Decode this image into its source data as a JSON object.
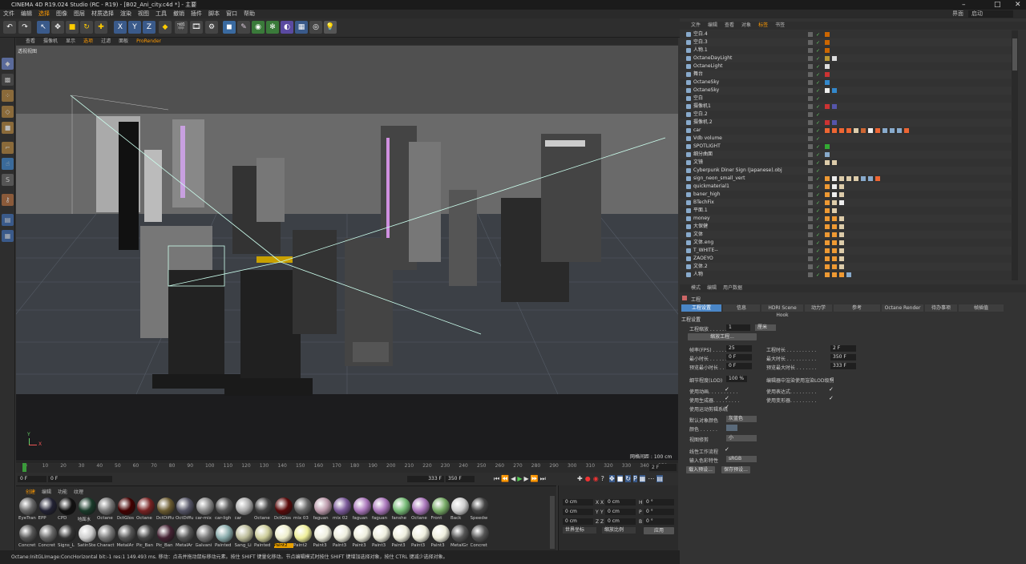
{
  "window": {
    "title": "CINEMA 4D R19.024 Studio (RC - R19) - [B02_Ani_city.c4d *] - 主要"
  },
  "menubar": {
    "items": [
      "文件",
      "编辑",
      "选择",
      "图像",
      "图层",
      "材质选择",
      "渲染",
      "视图",
      "工具",
      "撤销",
      "插件",
      "脚本",
      "窗口",
      "帮助"
    ],
    "active": "选择"
  },
  "layout": {
    "label": "界面",
    "value": "启动"
  },
  "toolbar": {
    "x": "X",
    "y": "Y",
    "z": "Z"
  },
  "viewport": {
    "menu": [
      "查看",
      "摄像机",
      "显示",
      "选项",
      "过滤",
      "面板",
      "ProRender"
    ],
    "label": "透视视图",
    "grid_label": "网格间距 : 100 cm",
    "axis_y": "Y",
    "axis_x": "X",
    "axis_z": "Z"
  },
  "timeline": {
    "ticks": [
      "0",
      "10",
      "20",
      "30",
      "40",
      "50",
      "60",
      "70",
      "80",
      "90",
      "100",
      "110",
      "120",
      "130",
      "140",
      "150",
      "160",
      "170",
      "180",
      "190",
      "200",
      "210",
      "220",
      "230",
      "240",
      "250",
      "260",
      "270",
      "280",
      "290",
      "300",
      "310",
      "320",
      "330",
      "340",
      "350"
    ],
    "current_frame": "2 F"
  },
  "transport": {
    "start": "0 F",
    "field2": "0 F",
    "end_a": "333 F",
    "end_b": "350 F"
  },
  "materials": {
    "menu": [
      "创建",
      "编辑",
      "功能",
      "纹理"
    ],
    "row1": [
      "EyeTran",
      "EPP",
      "CPD",
      "地面水",
      "Octane",
      "OctGlos",
      "Octane",
      "OctDiffu",
      "OctDiffu",
      "car-mix",
      "car-ligh",
      "car",
      "Octane",
      "OctGlos",
      "mix 03",
      "faguan",
      "mix 02",
      "faguan",
      "faguan",
      "fanshe",
      "Octane",
      "Front",
      "Back",
      "Speedw"
    ],
    "row2": [
      "Concret",
      "Concret",
      "Signs_L",
      "SatinSte",
      "Charact",
      "MetalAr",
      "Pic_Ban",
      "Pic_Ban",
      "MetalAr",
      "Galvani",
      "Painted",
      "Sang_Li",
      "Painted",
      "Paint2",
      "Paint2",
      "Paint3",
      "Paint3",
      "Paint3",
      "Paint3",
      "Paint3",
      "Paint3",
      "Paint3",
      "MetalGr",
      "Concret"
    ],
    "highlight": "Painted",
    "colors1": [
      "#666",
      "#223",
      "#111",
      "#1a3a2a",
      "#777",
      "#400",
      "#722",
      "#6a5a30",
      "#556",
      "#888",
      "#555",
      "#aaa",
      "#444",
      "#5a0a0a",
      "#666",
      "#b9a",
      "#7b5a9a",
      "#a7b",
      "#a7b",
      "#7b7",
      "#a7b",
      "#7a6",
      "#ccc",
      "#444"
    ],
    "colors2": [
      "#555",
      "#666",
      "#333",
      "#ccc",
      "#777",
      "#555",
      "#444",
      "#423",
      "#555",
      "#777",
      "#8aa",
      "#bb9",
      "#cc9",
      "#eec",
      "#ee9",
      "#eed",
      "#eed",
      "#eed",
      "#eed",
      "#eed",
      "#eed",
      "#eed",
      "#555",
      "#555"
    ]
  },
  "coords": {
    "x1": "X",
    "y1": "Y",
    "z1": "Z",
    "val": "0 cm",
    "x2": "X",
    "y2": "Y",
    "z2": "Z",
    "h": "H",
    "p": "P",
    "b": "B",
    "deg": "0 °",
    "mode1": "世界坐标",
    "mode2": "缩放比例",
    "apply": "应用"
  },
  "status": {
    "text": "Octane:InitGLImage:ConcHorizontal  bit:-1 res:1 149.493 ms.  移动：点击并拖动鼠标移动元素。按住 SHIFT 键量化移动。节点编辑模式时按住 SHIFT 键增加选择对象，按住 CTRL 键减少选择对象。"
  },
  "objmanager": {
    "menu": [
      "文件",
      "编辑",
      "查看",
      "对象",
      "标签",
      "书签"
    ],
    "active": "标签"
  },
  "objects": [
    {
      "name": "空白.4",
      "tags": [
        "#c60"
      ]
    },
    {
      "name": "空白.3",
      "tags": [
        "#c60"
      ]
    },
    {
      "name": "人物.1",
      "tags": [
        "#c60"
      ]
    },
    {
      "name": "OctaneDayLight",
      "tags": [
        "#b93",
        "#ddd"
      ]
    },
    {
      "name": "OctaneLight",
      "tags": [
        "#ddd"
      ]
    },
    {
      "name": "舞台",
      "tags": [
        "#c33"
      ]
    },
    {
      "name": "OctaneSky",
      "tags": [
        "#38c"
      ]
    },
    {
      "name": "OctaneSky",
      "tags": [
        "#eee",
        "#38c"
      ]
    },
    {
      "name": "空白",
      "tags": []
    },
    {
      "name": "摄像机1",
      "tags": [
        "#c33",
        "#55a"
      ]
    },
    {
      "name": "空白.2",
      "tags": []
    },
    {
      "name": "摄像机.2",
      "tags": [
        "#c33",
        "#55a"
      ]
    },
    {
      "name": "car",
      "tags": [
        "#e63",
        "#e63",
        "#e63",
        "#e63",
        "#dca",
        "#c63",
        "#eee",
        "#e63",
        "#8ac",
        "#8ac",
        "#8ac",
        "#e63"
      ]
    },
    {
      "name": "Vdb volume",
      "tags": []
    },
    {
      "name": "SPOTLIGHT",
      "tags": [
        "#3a3"
      ]
    },
    {
      "name": "细分曲面",
      "tags": [
        "#8ac"
      ]
    },
    {
      "name": "文镜",
      "tags": [
        "#dca",
        "#dca"
      ]
    },
    {
      "name": "Cyberpunk Diner Sign (Japanese).obj",
      "tags": []
    },
    {
      "name": "sign_neon_small_vert",
      "tags": [
        "#e93",
        "#eee",
        "#dca",
        "#dca",
        "#dca",
        "#8ac",
        "#8ac",
        "#e63"
      ]
    },
    {
      "name": "quickmaterial1",
      "tags": [
        "#e93",
        "#eee",
        "#dca"
      ]
    },
    {
      "name": "baner_high",
      "tags": [
        "#e93",
        "#eee",
        "#dca"
      ]
    },
    {
      "name": "BTechFix",
      "tags": [
        "#e93",
        "#dca",
        "#eee"
      ]
    },
    {
      "name": "平面.1",
      "tags": [
        "#e93",
        "#dca"
      ]
    },
    {
      "name": "money",
      "tags": [
        "#e93",
        "#e93",
        "#dca"
      ]
    },
    {
      "name": "大保健",
      "tags": [
        "#e93",
        "#e93",
        "#dca"
      ]
    },
    {
      "name": "文体",
      "tags": [
        "#e93",
        "#e93",
        "#dca"
      ]
    },
    {
      "name": "文体.eng",
      "tags": [
        "#e93",
        "#e93",
        "#dca"
      ]
    },
    {
      "name": "T_WHITE--",
      "tags": [
        "#e93",
        "#e93",
        "#dca"
      ]
    },
    {
      "name": "ZAOEYO",
      "tags": [
        "#e93",
        "#e93",
        "#dca"
      ]
    },
    {
      "name": "文体.2",
      "tags": [
        "#e93",
        "#e93",
        "#dca"
      ]
    },
    {
      "name": "人物",
      "tags": [
        "#e93",
        "#e93",
        "#e93",
        "#8ac"
      ]
    }
  ],
  "attrmanager": {
    "menu": [
      "模式",
      "编辑",
      "用户数据"
    ],
    "title": "工程",
    "tabs": [
      "工程设置",
      "信息",
      "HDRI Scene Hook",
      "动力学",
      "参考",
      "Octane Render",
      "待办事项",
      "帧插值"
    ],
    "section": "工程设置"
  },
  "attrs": {
    "scale_label": "工程缩放 . . . . . . . . .",
    "scale_val": "1",
    "scale_unit": "厘米",
    "scale_btn": "缩放工程...",
    "fps_label": "帧率(FPS) . . . . . . . .",
    "fps": "25",
    "len_label": "工程时长 . . . . . . . . . .",
    "len": "2 F",
    "min_label": "最小时长 . . . . . . . . . .",
    "min": "0 F",
    "max_label": "最大时长 . . . . . . . . . .",
    "max": "350 F",
    "pmin_label": "预览最小时长 . . . . . . .",
    "pmin": "0 F",
    "pmax_label": "预览最大时长 . . . . . . .",
    "pmax": "333 F",
    "lod_label": "细节程度(LOD)",
    "lod": "100 %",
    "lod2": "编辑器中渲染使用渲染LOD级别",
    "anim": "使用动画. . . . . . . . . .",
    "expr": "使用表达式. . . . . . . . .",
    "gen": "使用生成器. . . . . . . . .",
    "def": "使用变形器. . . . . . . . .",
    "motion": "使用运动剪辑系统",
    "defcol_label": "默认对象颜色",
    "defcol": "灰蓝色",
    "color_label": "颜色 . . . . . .",
    "viewclip_label": "视图修剪",
    "viewclip": "小",
    "linear_label": "线性工作流程",
    "input_label": "输入色彩特性",
    "input": "sRGB",
    "load_btn": "载入预设...",
    "save_btn": "保存预设..."
  }
}
